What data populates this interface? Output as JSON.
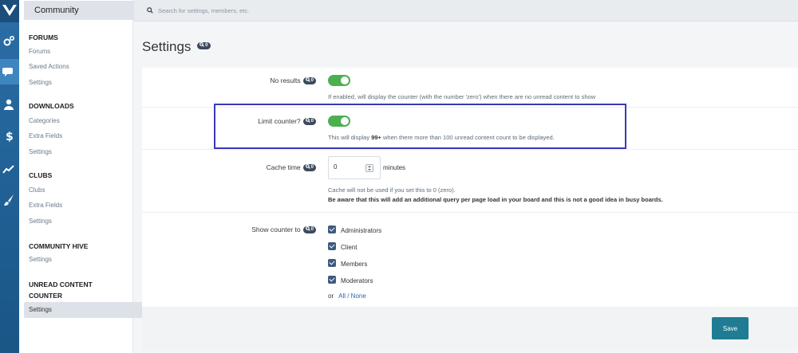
{
  "rail": {
    "icons": [
      "logo-icon",
      "gears-icon",
      "chat-icon",
      "user-icon",
      "dollar-icon",
      "chart-icon",
      "brush-icon"
    ]
  },
  "sidebar": {
    "title": "Community",
    "groups": [
      {
        "heading": "FORUMS",
        "links": [
          "Forums",
          "Saved Actions",
          "Settings"
        ]
      },
      {
        "heading": "DOWNLOADS",
        "links": [
          "Categories",
          "Extra Fields",
          "Settings"
        ]
      },
      {
        "heading": "CLUBS",
        "links": [
          "Clubs",
          "Extra Fields",
          "Settings"
        ]
      },
      {
        "heading": "COMMUNITY HIVE",
        "links": [
          "Settings"
        ]
      },
      {
        "heading": "UNREAD CONTENT COUNTER",
        "links": [
          "Settings"
        ]
      }
    ]
  },
  "search": {
    "placeholder": "Search for settings, members, etc."
  },
  "page": {
    "title": "Settings",
    "badge": "0"
  },
  "settings": {
    "no_results": {
      "label": "No results",
      "badge": "0",
      "enabled": true,
      "description": "If enabled, will display the counter (with the number 'zero') when there are no unread content to show"
    },
    "limit_counter": {
      "label": "Limit counter?",
      "badge": "0",
      "enabled": true,
      "desc_pre": "This will display ",
      "desc_bold": "99+",
      "desc_post": " when there more than 100 unread content count to be displayed."
    },
    "cache_time": {
      "label": "Cache time",
      "badge": "0",
      "value": "0",
      "unit": "minutes",
      "note1": "Cache will not be used if you set this to 0 (zero).",
      "note2": "Be aware that this will add an additional query per page load in your board and this is not a good idea in busy boards."
    },
    "show_counter": {
      "label": "Show counter to",
      "badge": "0",
      "options": [
        "Administrators",
        "Client",
        "Members",
        "Moderators"
      ],
      "or_text": "or",
      "all_none": "All / None"
    }
  },
  "footer": {
    "save_label": "Save"
  },
  "colors": {
    "accent": "#1f7c93",
    "toggle_on": "#4caf50",
    "highlight": "#3a39b8"
  }
}
